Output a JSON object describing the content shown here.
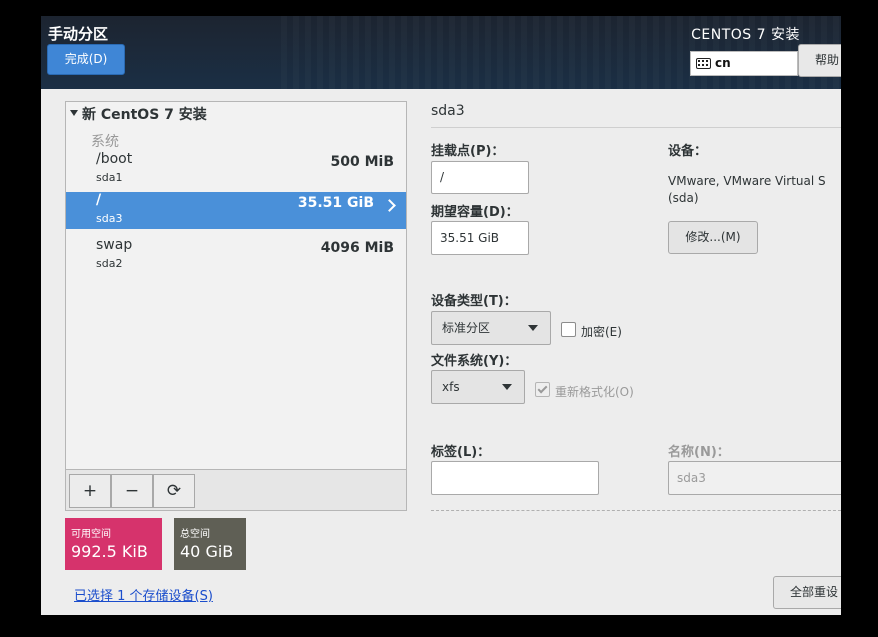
{
  "header": {
    "title": "手动分区",
    "done_label": "完成(D)",
    "product": "CENTOS 7 安装",
    "keyboard_layout": "cn",
    "help_label": "帮助"
  },
  "tree": {
    "root_label": "新 CentOS 7 安装",
    "group_label": "系统",
    "partitions": [
      {
        "mount": "/boot",
        "device": "sda1",
        "size": "500 MiB",
        "selected": false
      },
      {
        "mount": "/",
        "device": "sda3",
        "size": "35.51 GiB",
        "selected": true
      },
      {
        "mount": "swap",
        "device": "sda2",
        "size": "4096 MiB",
        "selected": false
      }
    ],
    "toolbar": {
      "add": "+",
      "remove": "−",
      "refresh": "⟳"
    }
  },
  "space": {
    "available_label": "可用空间",
    "available_value": "992.5 KiB",
    "total_label": "总空间",
    "total_value": "40 GiB"
  },
  "storage_link": "已选择 1 个存储设备(S)",
  "details": {
    "partition_name": "sda3",
    "mount_label": "挂载点(P)：",
    "mount_value": "/",
    "capacity_label": "期望容量(D)：",
    "capacity_value": "35.51 GiB",
    "device_label": "设备：",
    "device_desc": "VMware, VMware Virtual S (sda)",
    "modify_label": "修改...(M)",
    "device_type_label": "设备类型(T)：",
    "device_type_value": "标准分区",
    "encrypt_label": "加密(E)",
    "encrypt_checked": false,
    "fs_label": "文件系统(Y)：",
    "fs_value": "xfs",
    "reformat_label": "重新格式化(O)",
    "reformat_checked": true,
    "tag_label": "标签(L)：",
    "tag_value": "",
    "name_label": "名称(N)：",
    "name_value": "sda3",
    "reset_label": "全部重设"
  }
}
